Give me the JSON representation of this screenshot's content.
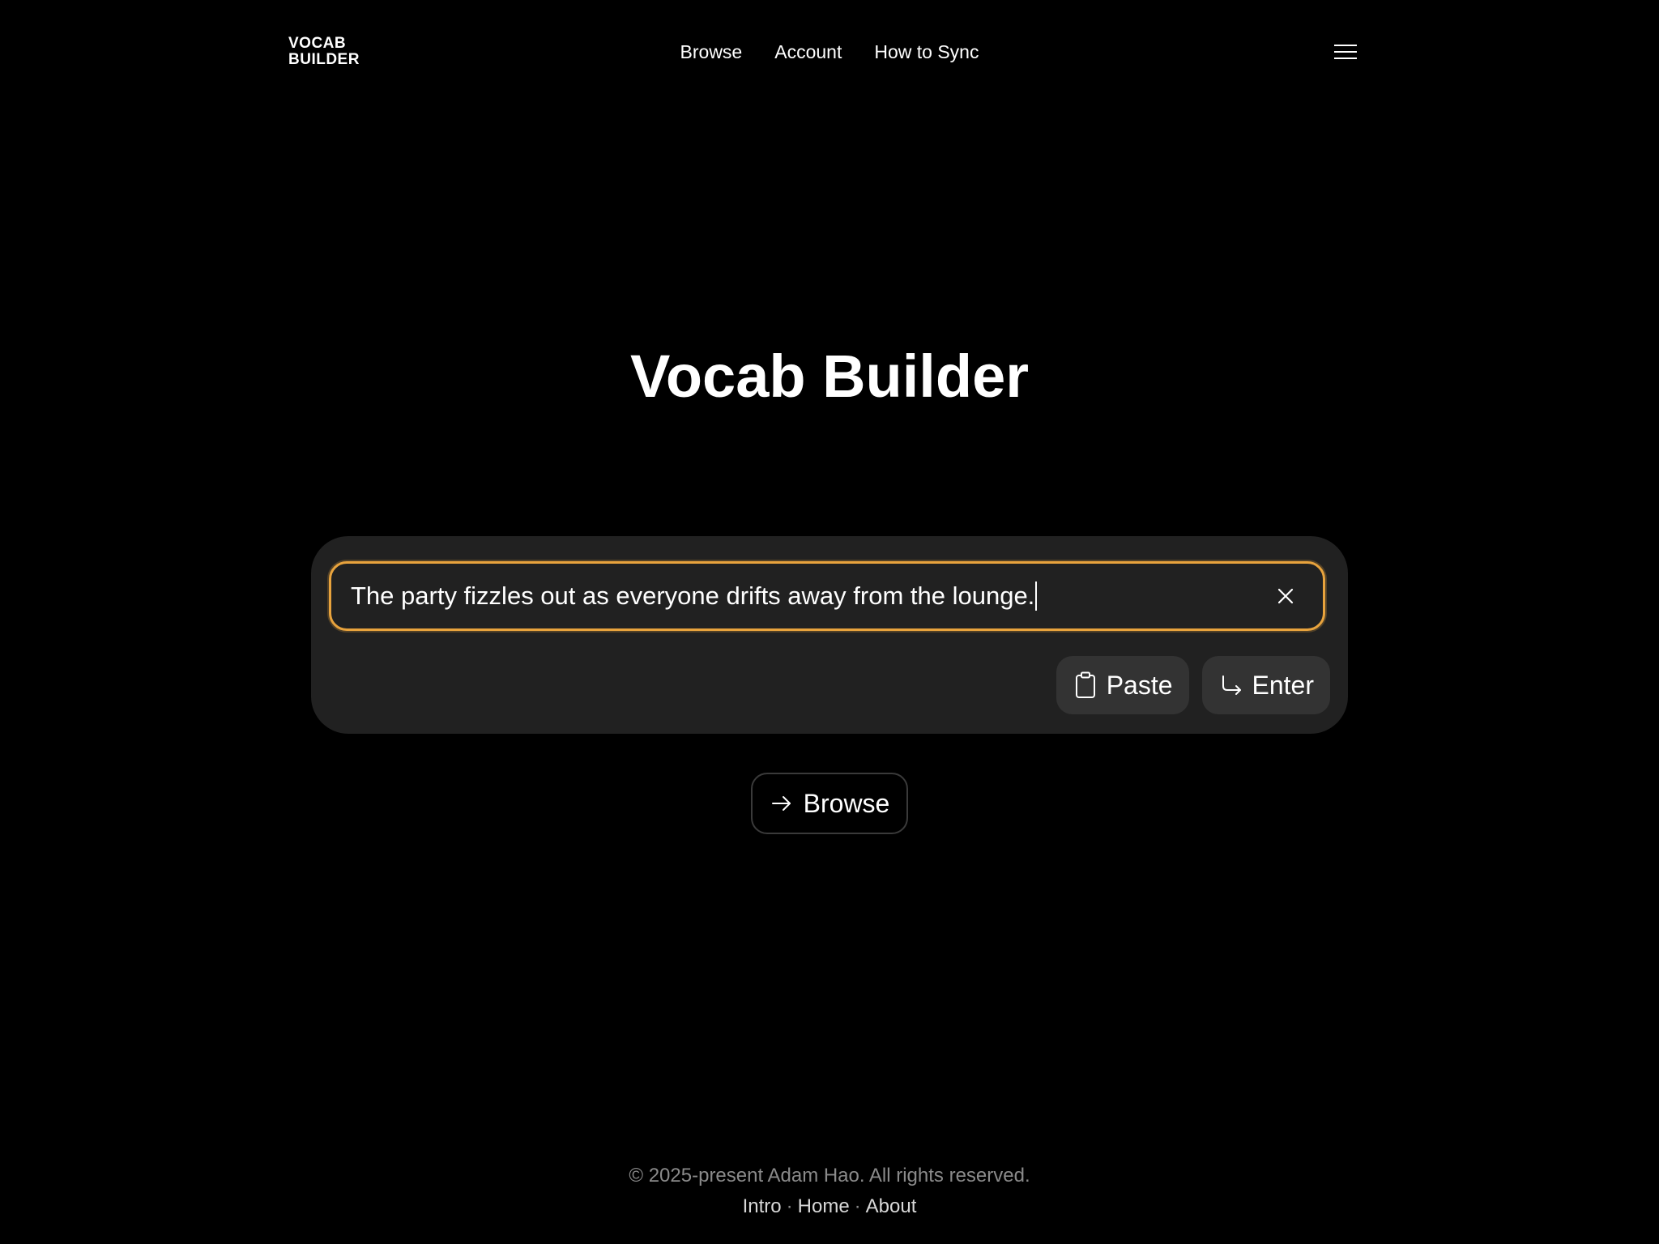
{
  "header": {
    "logo_line1": "VOCAB",
    "logo_line2": "BUILDER",
    "nav": {
      "browse": "Browse",
      "account": "Account",
      "how_to_sync": "How to Sync"
    },
    "menu_icon": "hamburger-menu-icon"
  },
  "hero": {
    "title": "Vocab Builder"
  },
  "input": {
    "value": "The party fizzles out as everyone drifts away from the lounge.",
    "clear_icon": "close-icon",
    "focus_color": "#e8a33d"
  },
  "actions": {
    "paste_label": "Paste",
    "paste_icon": "clipboard-icon",
    "enter_label": "Enter",
    "enter_icon": "return-arrow-icon"
  },
  "browse": {
    "label": "Browse",
    "icon": "arrow-right-icon"
  },
  "footer": {
    "copyright": "© 2025-present Adam Hao. All rights reserved.",
    "links": {
      "intro": "Intro",
      "home": "Home",
      "about": "About",
      "separator": "·"
    }
  },
  "colors": {
    "background": "#000000",
    "card": "#212121",
    "button": "#333333",
    "accent": "#e8a33d"
  }
}
